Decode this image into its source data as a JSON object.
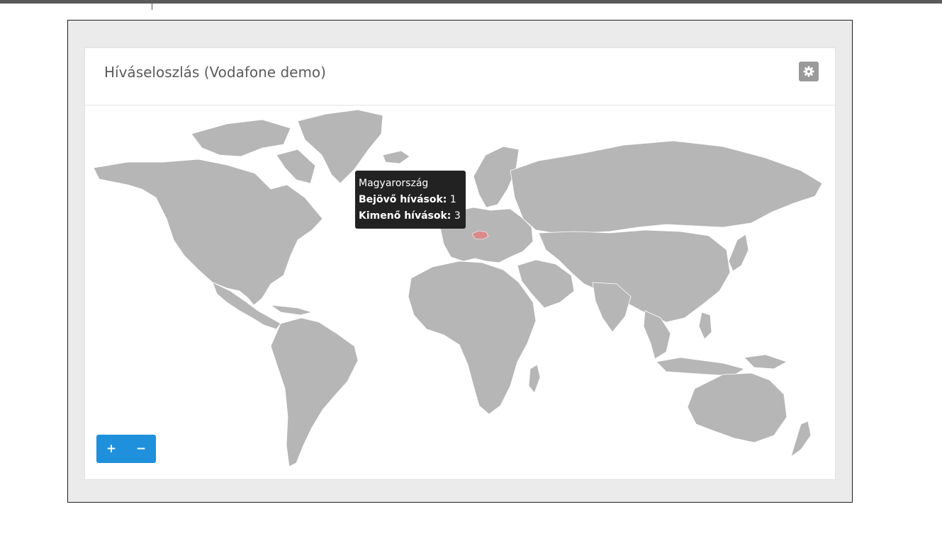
{
  "panel": {
    "title": "Híváseloszlás (Vodafone demo)",
    "settings_icon": "gear-icon"
  },
  "tooltip": {
    "country": "Magyarország",
    "incoming_label": "Bejövő hívások:",
    "incoming_value": "1",
    "outgoing_label": "Kimenő hívások:",
    "outgoing_value": "3"
  },
  "zoom": {
    "in_label": "+",
    "out_label": "−"
  },
  "colors": {
    "land": "#b6b6b6",
    "highlight": "#d98b8b",
    "accent": "#1e90dc"
  }
}
